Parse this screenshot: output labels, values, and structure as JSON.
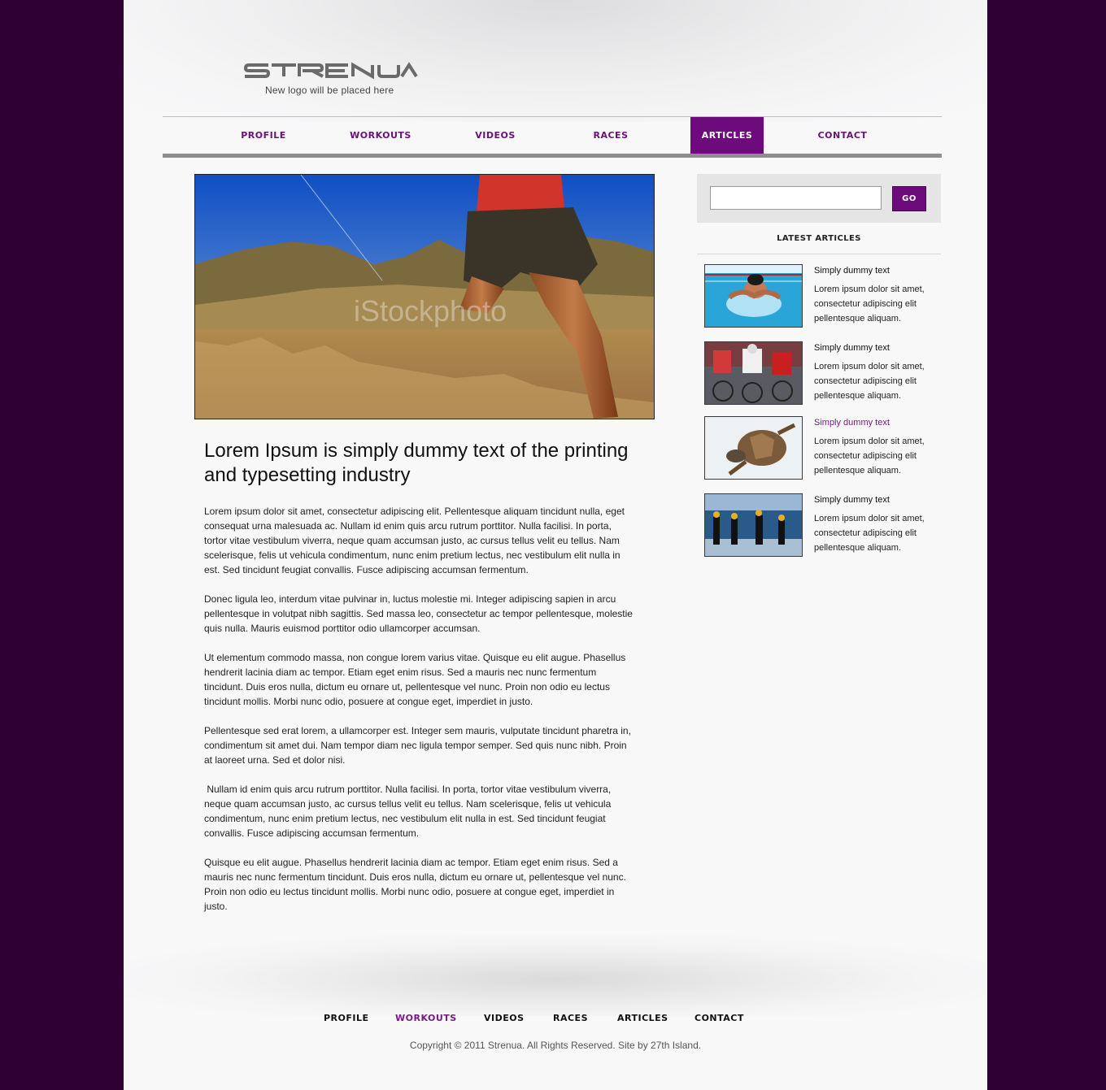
{
  "brand": {
    "logo": "STRENUA",
    "tagline": "New logo will be placed here"
  },
  "nav": {
    "items": [
      {
        "label": "PROFILE"
      },
      {
        "label": "WORKOUTS"
      },
      {
        "label": "VIDEOS"
      },
      {
        "label": "RACES"
      },
      {
        "label": "ARTICLES",
        "active": true
      },
      {
        "label": "CONTACT"
      }
    ]
  },
  "hero": {
    "watermark": "iStockphoto"
  },
  "article": {
    "title": "Lorem Ipsum is simply dummy text of the printing and typesetting industry",
    "paragraphs": [
      "Lorem ipsum dolor sit amet, consectetur adipiscing elit. Pellentesque aliquam tincidunt nulla, eget consequat urna malesuada ac. Nullam id enim quis arcu rutrum porttitor. Nulla facilisi. In porta, tortor vitae vestibulum viverra, neque quam accumsan justo, ac cursus tellus velit eu tellus. Nam scelerisque, felis ut vehicula condimentum, nunc enim pretium lectus, nec vestibulum elit nulla in est. Sed tincidunt feugiat convallis. Fusce adipiscing accumsan fermentum.",
      "Donec ligula leo, interdum vitae pulvinar in, luctus molestie mi. Integer adipiscing sapien in arcu pellentesque in volutpat nibh sagittis. Sed massa leo, consectetur ac tempor pellentesque, molestie quis nulla. Mauris euismod porttitor odio ullamcorper accumsan.",
      "Ut elementum commodo massa, non congue lorem varius vitae. Quisque eu elit augue. Phasellus hendrerit lacinia diam ac tempor. Etiam eget enim risus. Sed a mauris nec nunc fermentum tincidunt. Duis eros nulla, dictum eu ornare ut, pellentesque vel nunc. Proin non odio eu lectus tincidunt mollis. Morbi nunc odio, posuere at congue eget, imperdiet in justo.",
      "Pellentesque sed erat lorem, a ullamcorper est. Integer sem mauris, vulputate tincidunt pharetra in, condimentum sit amet dui. Nam tempor diam nec ligula tempor semper. Sed quis nunc nibh. Proin at laoreet urna. Sed et dolor nisi.",
      " Nullam id enim quis arcu rutrum porttitor. Nulla facilisi. In porta, tortor vitae vestibulum viverra, neque quam accumsan justo, ac cursus tellus velit eu tellus. Nam scelerisque, felis ut vehicula condimentum, nunc enim pretium lectus, nec vestibulum elit nulla in est. Sed tincidunt feugiat convallis. Fusce adipiscing accumsan fermentum.",
      "Quisque eu elit augue. Phasellus hendrerit lacinia diam ac tempor. Etiam eget enim risus. Sed a mauris nec nunc fermentum tincidunt. Duis eros nulla, dictum eu ornare ut, pellentesque vel nunc. Proin non odio eu lectus tincidunt mollis. Morbi nunc odio, posuere at congue eget, imperdiet in justo."
    ]
  },
  "sidebar": {
    "search": {
      "placeholder": "",
      "value": "",
      "button": "GO"
    },
    "heading": "LATEST ARTICLES",
    "articles": [
      {
        "title": "Simply dummy text",
        "text": "Lorem ipsum dolor sit amet, consectetur adipiscing elit pellentesque aliquam.",
        "thumb": "swimmer",
        "highlighted": false
      },
      {
        "title": "Simply dummy text",
        "text": "Lorem ipsum dolor sit amet, consectetur adipiscing elit pellentesque aliquam.",
        "thumb": "cyclists",
        "highlighted": false
      },
      {
        "title": "Simply dummy text",
        "text": "Lorem ipsum dolor sit amet, consectetur adipiscing elit pellentesque aliquam.",
        "thumb": "turtle",
        "highlighted": true
      },
      {
        "title": "Simply dummy text",
        "text": "Lorem ipsum dolor sit amet, consectetur adipiscing elit pellentesque aliquam.",
        "thumb": "triathletes",
        "highlighted": false
      }
    ]
  },
  "footer": {
    "nav": [
      {
        "label": "PROFILE"
      },
      {
        "label": "WORKOUTS",
        "highlighted": true
      },
      {
        "label": "VIDEOS"
      },
      {
        "label": "RACES"
      },
      {
        "label": "ARTICLES"
      },
      {
        "label": "CONTACT"
      }
    ],
    "copyright": "Copyright © 2011 Strenua. All Rights Reserved. Site by 27th Island."
  },
  "colors": {
    "outer_background": "#2e0033",
    "accent": "#6d0a7c",
    "nav_text": "#6b0f7a"
  }
}
